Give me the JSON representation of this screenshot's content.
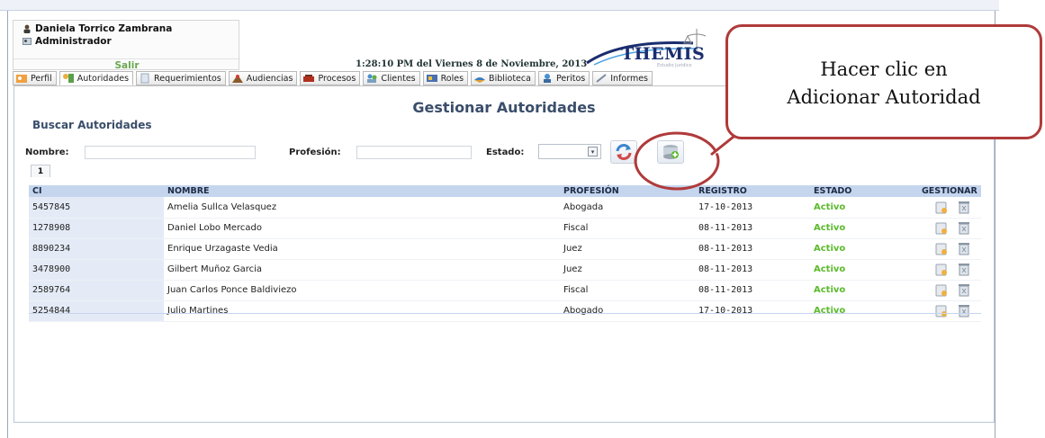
{
  "user": {
    "name": "Daniela Torrico Zambrana",
    "role": "Administrador",
    "logout_label": "Salir"
  },
  "clock": "1:28:10 PM del Viernes 8 de Noviembre, 2013",
  "logo": {
    "text": "THEMIS",
    "subtitle": "Estudio Jurídico"
  },
  "tabs": [
    {
      "label": "Perfil",
      "icon": "profile-icon"
    },
    {
      "label": "Autoridades",
      "icon": "authority-icon",
      "active": true
    },
    {
      "label": "Requerimientos",
      "icon": "requirements-icon"
    },
    {
      "label": "Audiencias",
      "icon": "hearings-icon"
    },
    {
      "label": "Procesos",
      "icon": "processes-icon"
    },
    {
      "label": "Clientes",
      "icon": "clients-icon"
    },
    {
      "label": "Roles",
      "icon": "roles-icon"
    },
    {
      "label": "Biblioteca",
      "icon": "library-icon"
    },
    {
      "label": "Peritos",
      "icon": "experts-icon"
    },
    {
      "label": "Informes",
      "icon": "reports-icon"
    }
  ],
  "page": {
    "title": "Gestionar Autoridades",
    "subtitle": "Buscar Autoridades"
  },
  "filters": {
    "name_label": "Nombre:",
    "profession_label": "Profesión:",
    "status_label": "Estado:",
    "status_value": ""
  },
  "pagination": {
    "current": "1"
  },
  "table": {
    "headers": [
      "CI",
      "NOMBRE",
      "PROFESIÓN",
      "REGISTRO",
      "ESTADO",
      "GESTIONAR"
    ],
    "rows": [
      {
        "ci": "5457845",
        "nombre": "Amelia Sullca Velasquez",
        "profesion": "Abogada",
        "registro": "17-10-2013",
        "estado": "Activo"
      },
      {
        "ci": "1278908",
        "nombre": "Daniel Lobo Mercado",
        "profesion": "Fiscal",
        "registro": "08-11-2013",
        "estado": "Activo"
      },
      {
        "ci": "8890234",
        "nombre": "Enrique Urzagaste Vedia",
        "profesion": "Juez",
        "registro": "08-11-2013",
        "estado": "Activo"
      },
      {
        "ci": "3478900",
        "nombre": "Gilbert Muñoz Garcia",
        "profesion": "Juez",
        "registro": "08-11-2013",
        "estado": "Activo"
      },
      {
        "ci": "2589764",
        "nombre": "Juan Carlos Ponce Baldiviezo",
        "profesion": "Fiscal",
        "registro": "08-11-2013",
        "estado": "Activo"
      },
      {
        "ci": "5254844",
        "nombre": "Julio Martines",
        "profesion": "Abogado",
        "registro": "17-10-2013",
        "estado": "Activo"
      }
    ]
  },
  "callout": {
    "line1": "Hacer clic en",
    "line2": "Adicionar Autoridad"
  },
  "colors": {
    "accent_green": "#5bbb2c",
    "header_blue": "#c5d5ee",
    "title_blue": "#3a4e6a",
    "callout_red": "#b03a3a"
  }
}
